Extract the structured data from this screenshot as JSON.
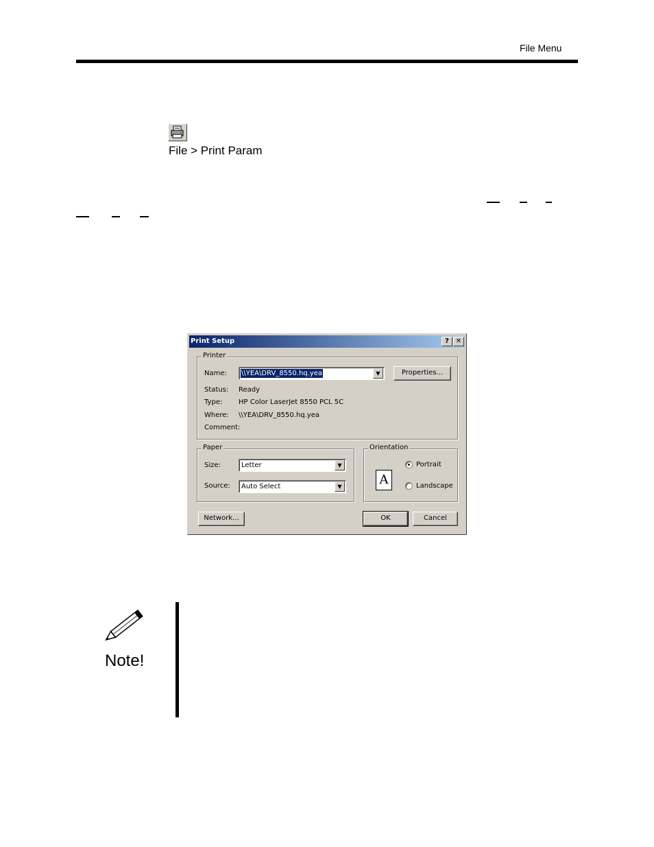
{
  "header": {
    "title": "File Menu"
  },
  "toolbar": {
    "icon": "printer-icon",
    "menu_path": "File > Print Param"
  },
  "dialog": {
    "title": "Print Setup",
    "help_button": "?",
    "close_button": "✕",
    "printer": {
      "group_label": "Printer",
      "name_label": "Name:",
      "name_value": "\\\\YEA\\DRV_8550.hq.yea",
      "properties_button": "Properties...",
      "status_label": "Status:",
      "status_value": "Ready",
      "type_label": "Type:",
      "type_value": "HP Color LaserJet 8550 PCL 5C",
      "where_label": "Where:",
      "where_value": "\\\\YEA\\DRV_8550.hq.yea",
      "comment_label": "Comment:",
      "comment_value": ""
    },
    "paper": {
      "group_label": "Paper",
      "size_label": "Size:",
      "size_value": "Letter",
      "source_label": "Source:",
      "source_value": "Auto Select"
    },
    "orientation": {
      "group_label": "Orientation",
      "page_glyph": "A",
      "portrait_label": "Portrait",
      "landscape_label": "Landscape",
      "selected": "Portrait"
    },
    "network_button": "Network...",
    "ok_button": "OK",
    "cancel_button": "Cancel"
  },
  "note": {
    "label": "Note!",
    "icon": "pencil-icon"
  }
}
